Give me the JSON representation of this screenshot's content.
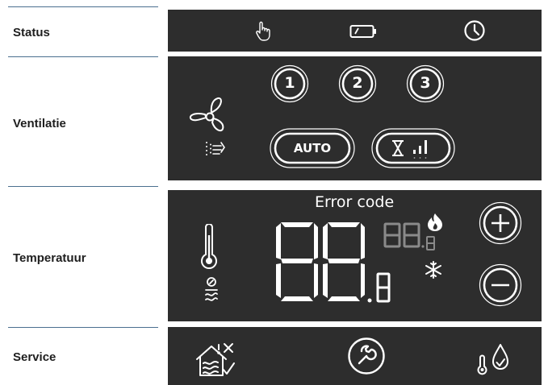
{
  "rows": {
    "status": {
      "label": "Status"
    },
    "ventilatie": {
      "label": "Ventilatie",
      "buttons": {
        "speed1": "1",
        "speed2": "2",
        "speed3": "3",
        "auto": "AUTO"
      }
    },
    "temperatuur": {
      "label": "Temperatuur",
      "error_label": "Error code",
      "main_digits": "88",
      "main_decimal": ".8",
      "small_digits": "88",
      "small_decimal": ".8"
    },
    "service": {
      "label": "Service"
    }
  },
  "icons": {
    "status": [
      "hand-touch-icon",
      "battery-icon",
      "clock-icon"
    ],
    "ventilatie": [
      "fan-icon",
      "air-filter-flow-icon",
      "hourglass-boost-icon"
    ],
    "temperatuur": [
      "thermometer-icon",
      "outdoor-air-icon",
      "flame-icon",
      "snowflake-icon",
      "plus-icon",
      "minus-icon"
    ],
    "service": [
      "house-alert-check-icon",
      "wrench-icon",
      "thermometer-droplet-icon"
    ]
  },
  "colors": {
    "panel": "#2d2d2d",
    "display_on": "#ffffff",
    "display_dim": "#8a8a8a",
    "divider": "#4a6f8f"
  }
}
